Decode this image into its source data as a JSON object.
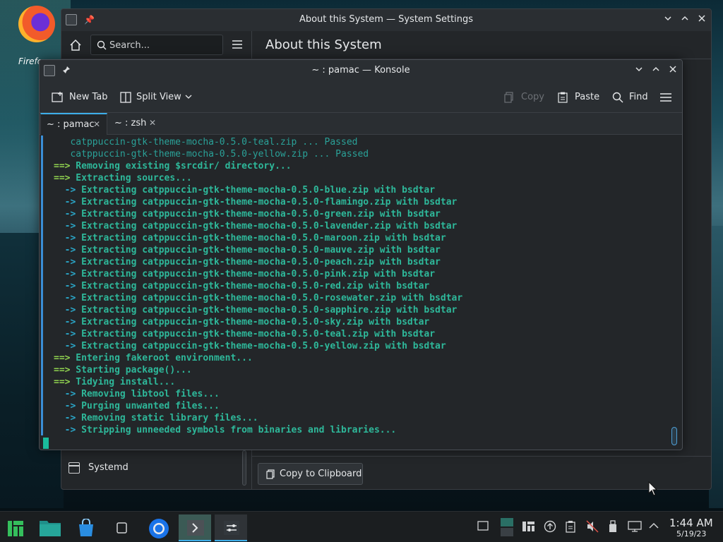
{
  "desktop": {
    "icon_label": "Firefox"
  },
  "settings_window": {
    "title": "About this System — System Settings",
    "search_placeholder": "Search...",
    "page_title": "About this System",
    "sidebar_items": [
      {
        "label": "Systemd",
        "icon": "systemd-icon"
      }
    ],
    "copy_clipboard_label": "Copy to Clipboard"
  },
  "konsole_window": {
    "title": "~ : pamac — Konsole",
    "toolbar": {
      "new_tab": "New Tab",
      "split_view": "Split View",
      "copy": "Copy",
      "paste": "Paste",
      "find": "Find"
    },
    "tabs": [
      {
        "label": "~ : pamac",
        "active": true
      },
      {
        "label": "~ : zsh",
        "active": false
      }
    ],
    "lines": [
      {
        "style": "faint",
        "prefix": "",
        "text": "catppuccin-gtk-theme-mocha-0.5.0-teal.zip ... Passed"
      },
      {
        "style": "faint",
        "prefix": "",
        "text": "catppuccin-gtk-theme-mocha-0.5.0-yellow.zip ... Passed"
      },
      {
        "style": "main",
        "prefix": "==>",
        "text": "Removing existing $srcdir/ directory..."
      },
      {
        "style": "main",
        "prefix": "==>",
        "text": "Extracting sources..."
      },
      {
        "style": "sub",
        "prefix": "->",
        "text": "Extracting catppuccin-gtk-theme-mocha-0.5.0-blue.zip with bsdtar"
      },
      {
        "style": "sub",
        "prefix": "->",
        "text": "Extracting catppuccin-gtk-theme-mocha-0.5.0-flamingo.zip with bsdtar"
      },
      {
        "style": "sub",
        "prefix": "->",
        "text": "Extracting catppuccin-gtk-theme-mocha-0.5.0-green.zip with bsdtar"
      },
      {
        "style": "sub",
        "prefix": "->",
        "text": "Extracting catppuccin-gtk-theme-mocha-0.5.0-lavender.zip with bsdtar"
      },
      {
        "style": "sub",
        "prefix": "->",
        "text": "Extracting catppuccin-gtk-theme-mocha-0.5.0-maroon.zip with bsdtar"
      },
      {
        "style": "sub",
        "prefix": "->",
        "text": "Extracting catppuccin-gtk-theme-mocha-0.5.0-mauve.zip with bsdtar"
      },
      {
        "style": "sub",
        "prefix": "->",
        "text": "Extracting catppuccin-gtk-theme-mocha-0.5.0-peach.zip with bsdtar"
      },
      {
        "style": "sub",
        "prefix": "->",
        "text": "Extracting catppuccin-gtk-theme-mocha-0.5.0-pink.zip with bsdtar"
      },
      {
        "style": "sub",
        "prefix": "->",
        "text": "Extracting catppuccin-gtk-theme-mocha-0.5.0-red.zip with bsdtar"
      },
      {
        "style": "sub",
        "prefix": "->",
        "text": "Extracting catppuccin-gtk-theme-mocha-0.5.0-rosewater.zip with bsdtar"
      },
      {
        "style": "sub",
        "prefix": "->",
        "text": "Extracting catppuccin-gtk-theme-mocha-0.5.0-sapphire.zip with bsdtar"
      },
      {
        "style": "sub",
        "prefix": "->",
        "text": "Extracting catppuccin-gtk-theme-mocha-0.5.0-sky.zip with bsdtar"
      },
      {
        "style": "sub",
        "prefix": "->",
        "text": "Extracting catppuccin-gtk-theme-mocha-0.5.0-teal.zip with bsdtar"
      },
      {
        "style": "sub",
        "prefix": "->",
        "text": "Extracting catppuccin-gtk-theme-mocha-0.5.0-yellow.zip with bsdtar"
      },
      {
        "style": "main",
        "prefix": "==>",
        "text": "Entering fakeroot environment..."
      },
      {
        "style": "main",
        "prefix": "==>",
        "text": "Starting package()..."
      },
      {
        "style": "main",
        "prefix": "==>",
        "text": "Tidying install..."
      },
      {
        "style": "sub",
        "prefix": "->",
        "text": "Removing libtool files..."
      },
      {
        "style": "sub",
        "prefix": "->",
        "text": "Purging unwanted files..."
      },
      {
        "style": "sub",
        "prefix": "->",
        "text": "Removing static library files..."
      },
      {
        "style": "sub",
        "prefix": "->",
        "text": "Stripping unneeded symbols from binaries and libraries..."
      }
    ]
  },
  "taskbar": {
    "items": [
      {
        "name": "app-launcher",
        "icon": "manjaro-icon"
      },
      {
        "name": "file-manager",
        "icon": "folder-icon"
      },
      {
        "name": "software-store",
        "icon": "store-icon"
      },
      {
        "name": "notes",
        "icon": "notes-icon"
      },
      {
        "name": "chromium",
        "icon": "chromium-icon"
      },
      {
        "name": "konsole",
        "icon": "terminal-icon"
      },
      {
        "name": "system-settings",
        "icon": "settings-icon"
      }
    ],
    "clock": {
      "time": "1:44 AM",
      "date": "5/19/23"
    }
  },
  "colors": {
    "accent": "#3daee9",
    "terminal_green": "#8fd14f",
    "terminal_blue": "#2aa6c8",
    "terminal_text": "#2eb89a"
  }
}
